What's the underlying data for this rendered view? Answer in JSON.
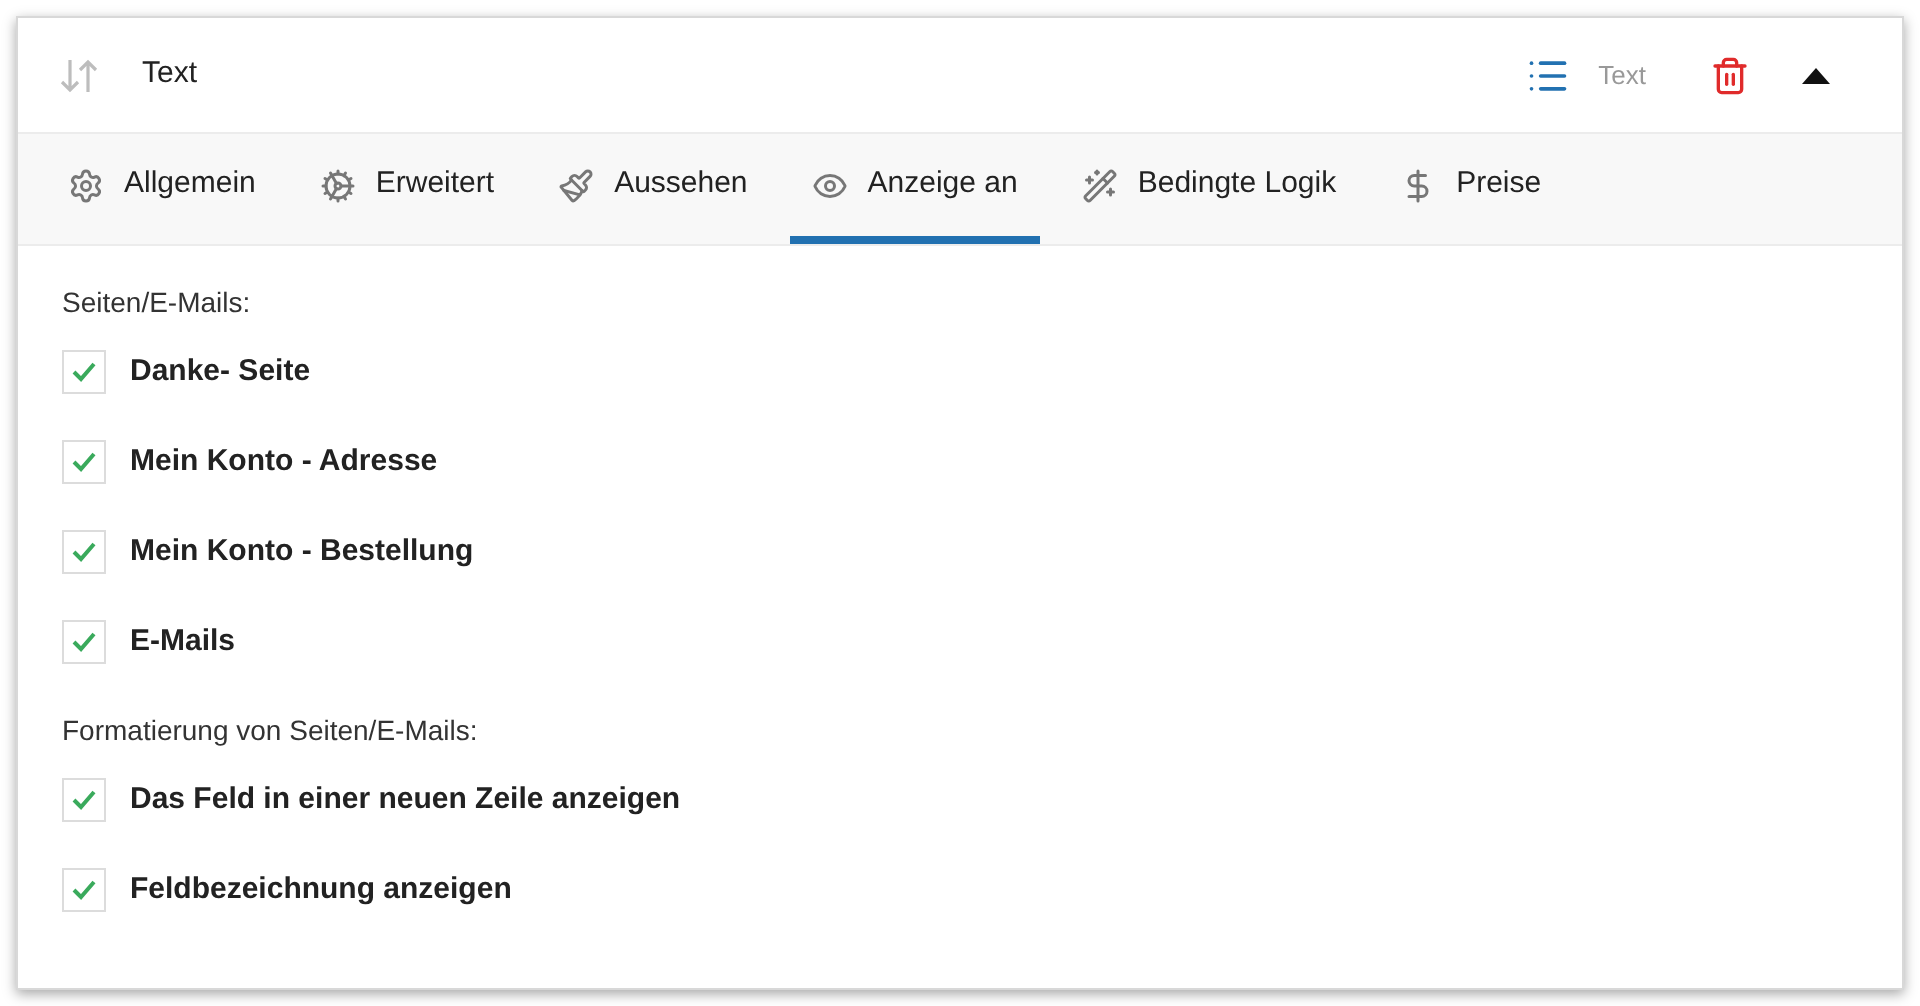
{
  "header": {
    "title": "Text",
    "type_label": "Text"
  },
  "tabs": [
    {
      "label": "Allgemein",
      "selected": false
    },
    {
      "label": "Erweitert",
      "selected": false
    },
    {
      "label": "Aussehen",
      "selected": false
    },
    {
      "label": "Anzeige an",
      "selected": true
    },
    {
      "label": "Bedingte Logik",
      "selected": false
    },
    {
      "label": "Preise",
      "selected": false
    }
  ],
  "groups": [
    {
      "heading": "Seiten/E-Mails:",
      "options": [
        {
          "label": "Danke- Seite",
          "checked": true
        },
        {
          "label": "Mein Konto - Adresse",
          "checked": true
        },
        {
          "label": "Mein Konto - Bestellung",
          "checked": true
        },
        {
          "label": "E-Mails",
          "checked": true
        }
      ]
    },
    {
      "heading": "Formatierung von Seiten/E-Mails:",
      "options": [
        {
          "label": "Das Feld in einer neuen Zeile anzeigen",
          "checked": true
        },
        {
          "label": "Feldbezeichnung anzeigen",
          "checked": true
        }
      ]
    }
  ]
}
